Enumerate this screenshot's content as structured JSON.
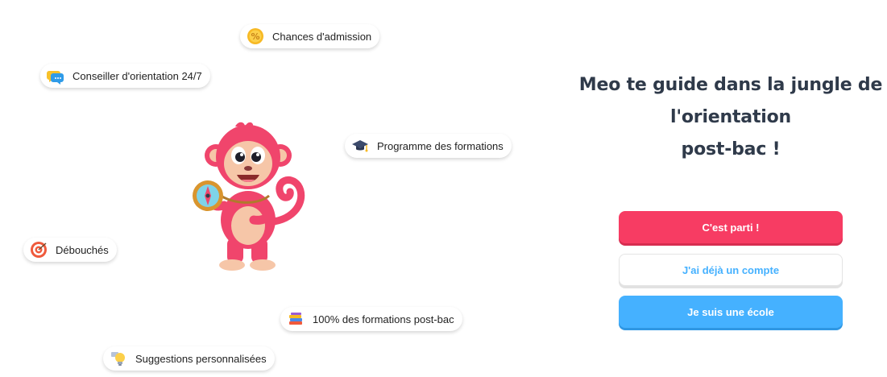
{
  "chips": {
    "admission": {
      "label": "Chances d'admission",
      "icon": "percent-coin-icon"
    },
    "conseiller": {
      "label": "Conseiller d'orientation 24/7",
      "icon": "chat-bubble-icon"
    },
    "programme": {
      "label": "Programme des formations",
      "icon": "graduation-cap-icon"
    },
    "debouches": {
      "label": "Débouchés",
      "icon": "target-icon"
    },
    "formations": {
      "label": "100% des formations post-bac",
      "icon": "books-icon"
    },
    "suggestions": {
      "label": "Suggestions personnalisées",
      "icon": "lightbulb-icon"
    }
  },
  "hero": {
    "title_line1": "Meo te guide dans la jungle de",
    "title_line2": "l'orientation",
    "title_line3": "post-bac !"
  },
  "buttons": {
    "start": "C'est parti !",
    "login": "J'ai déjà un compte",
    "school": "Je suis une école"
  },
  "colors": {
    "primary_pink": "#f73c63",
    "primary_blue": "#45b1ff",
    "title_text": "#2f3a4a"
  }
}
